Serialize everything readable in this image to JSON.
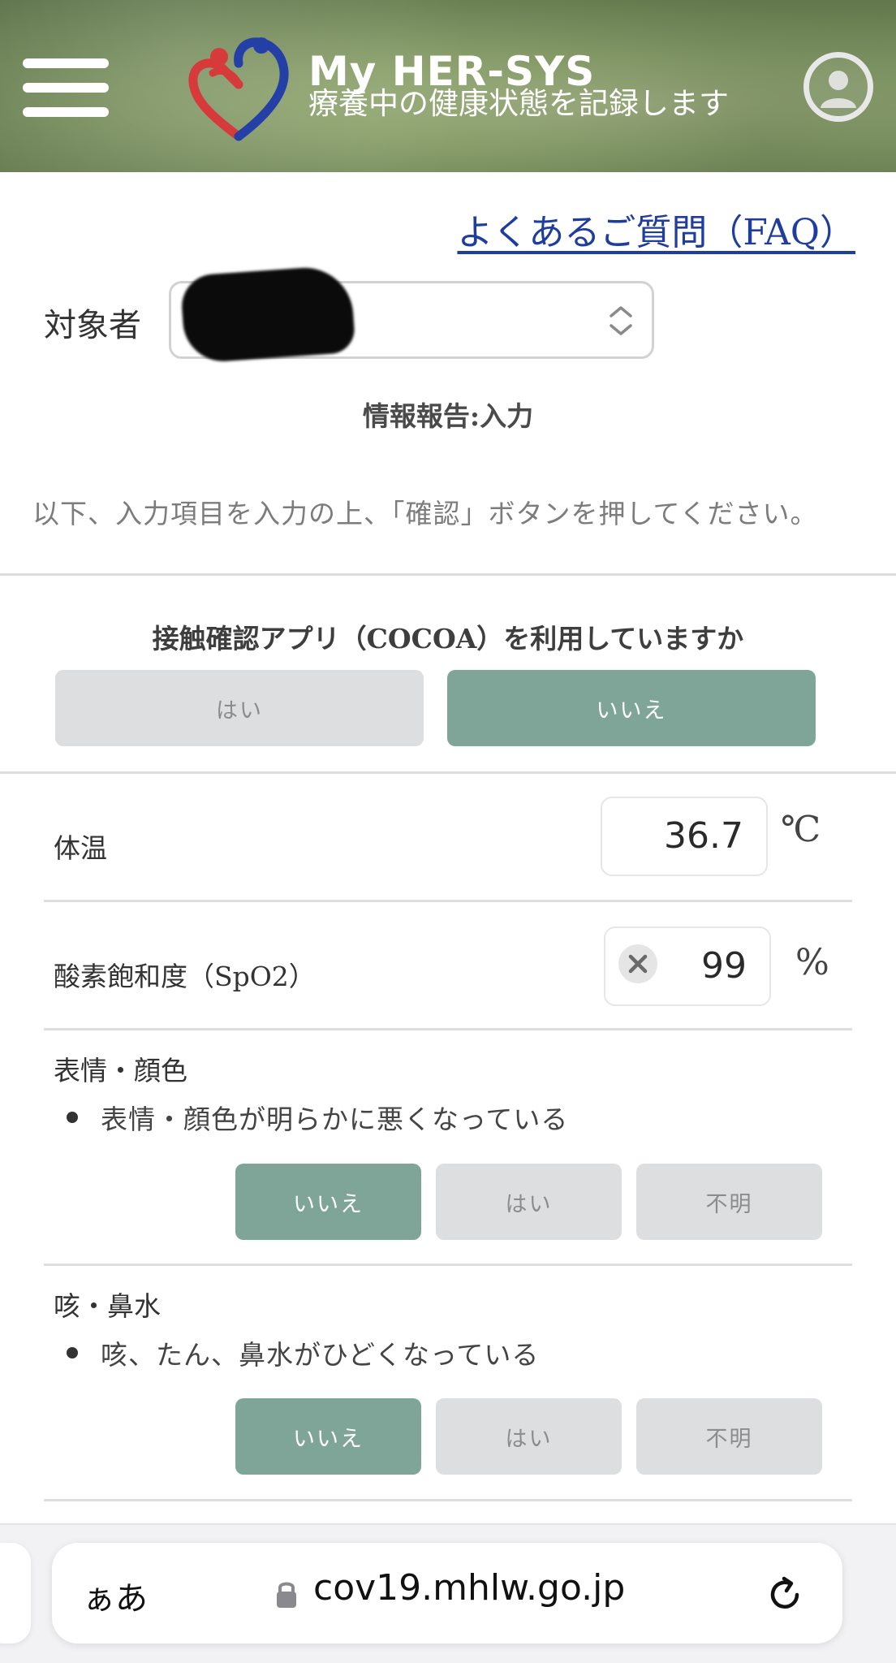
{
  "header": {
    "brand_title": "My HER-SYS",
    "brand_subtitle": "療養中の健康状態を記録します"
  },
  "faq_link": "よくあるご質問（FAQ）",
  "subject": {
    "label": "対象者",
    "value": ""
  },
  "section_heading": "情報報告:入力",
  "instruction": "以下、入力項目を入力の上、「確認」ボタンを押してください。",
  "cocoa": {
    "question": "接触確認アプリ（COCOA）を利用していますか",
    "options": [
      "はい",
      "いいえ"
    ],
    "selected": "いいえ"
  },
  "temperature": {
    "label": "体温",
    "value": "36.7",
    "unit": "℃"
  },
  "spo2": {
    "label": "酸素飽和度（SpO2）",
    "value": "99",
    "unit": "%"
  },
  "face_color": {
    "heading": "表情・顔色",
    "item": "表情・顔色が明らかに悪くなっている",
    "options": [
      "いいえ",
      "はい",
      "不明"
    ],
    "selected": "いいえ"
  },
  "cough": {
    "heading": "咳・鼻水",
    "item": "咳、たん、鼻水がひどくなっている",
    "options": [
      "いいえ",
      "はい",
      "不明"
    ],
    "selected": "いいえ"
  },
  "browser": {
    "aa_label": "ぁあ",
    "url": "cov19.mhlw.go.jp"
  },
  "colors": {
    "selected_button": "#7ea597",
    "unselected_button": "#dcdee0",
    "link": "#1f3d9e"
  }
}
